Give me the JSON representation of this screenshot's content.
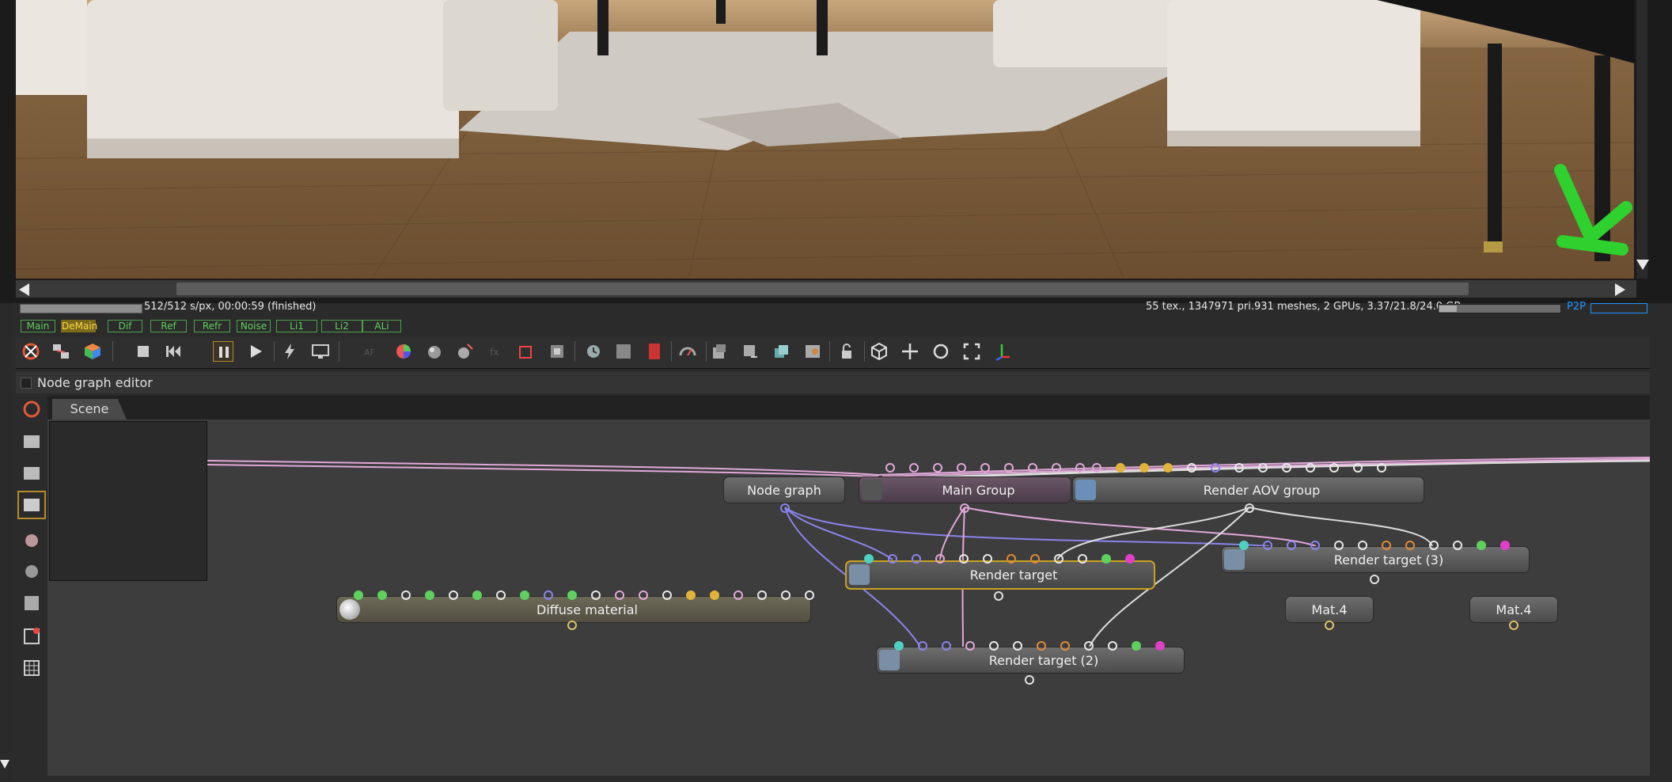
{
  "status": {
    "render_info": "512/512 s/px, 00:00:59 (finished)",
    "scene_info": "55 tex., 1347971 pri.931 meshes, 2 GPUs, 3.37/21.8/24.0 GB",
    "p2p_label": "P2P"
  },
  "passes": [
    "Main",
    "DeMain",
    "Dif",
    "Ref",
    "Refr",
    "Noise",
    "Li1",
    "Li2",
    "ALi"
  ],
  "active_pass": "DeMain",
  "node_editor": {
    "title": "Node graph editor",
    "tab": "Scene",
    "nodes": {
      "node_graph": "Node graph",
      "main_group": "Main Group",
      "render_aov_group": "Render AOV group",
      "render_target": "Render target",
      "render_target_2": "Render target (2)",
      "render_target_3": "Render target (3)",
      "diffuse_material": "Diffuse material",
      "mat4_a": "Mat.4",
      "mat4_b": "Mat.4"
    }
  },
  "colors": {
    "pass_border": "#4da24d",
    "pass_text": "#5fd05f",
    "pass_active_bg": "#7a6a1a",
    "p2p": "#2196ff",
    "selected_node_border": "#c9a21e",
    "wire_pink": "#e0a8d8",
    "wire_blue": "#8a84e8",
    "annotation_green": "#2ed12e"
  },
  "icons": {
    "toolbar": [
      "octane-logo-icon",
      "network-icon",
      "cube-color-icon",
      "stop-icon",
      "restart-icon",
      "pause-icon",
      "play-icon",
      "lightning-icon",
      "monitor-icon",
      "af-icon",
      "color-wheel-icon",
      "sphere-icon",
      "sphere-pick-icon",
      "fx-icon",
      "region-icon",
      "aperture-icon",
      "camera-clock-icon",
      "grid-pattern-icon",
      "pdf-icon",
      "speedometer-icon",
      "import-icon",
      "export-icon",
      "layers-icon",
      "picture-icon",
      "lock-icon",
      "cube-icon",
      "move-icon",
      "rotate-icon",
      "fullscreen-icon",
      "axes-icon"
    ],
    "sidebar": [
      "octane-logo-icon",
      "network-icon",
      "graph-icon",
      "render-target-icon",
      "palette-icon",
      "sphere-icon",
      "material-icon",
      "grid-magnet-icon",
      "table-icon"
    ]
  }
}
